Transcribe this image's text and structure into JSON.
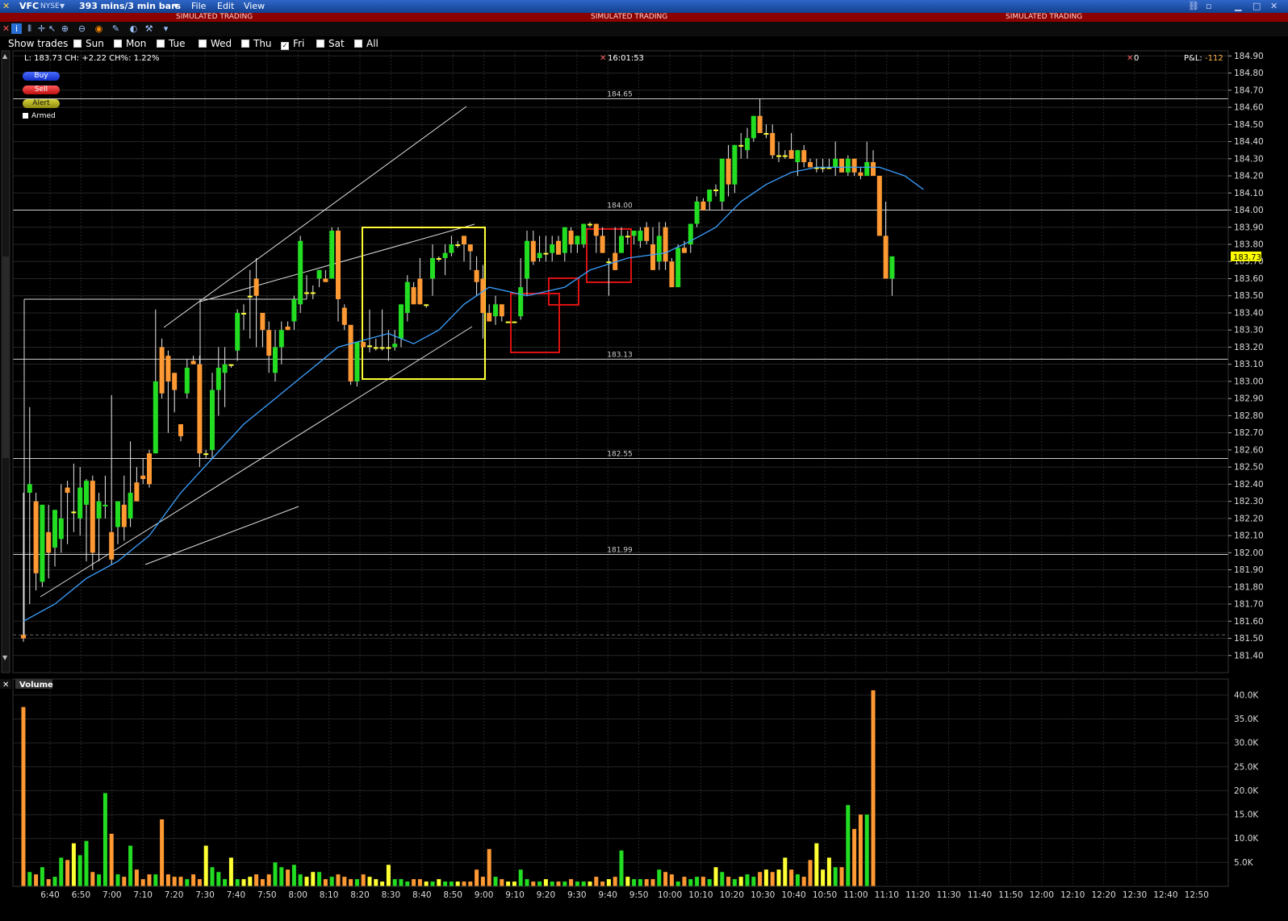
{
  "window": {
    "symbol": "VFC",
    "exchange": "NYSE",
    "bar_setting": "393 mins/3 min bars",
    "menu": [
      "File",
      "Edit",
      "View"
    ],
    "simulated_label": "SIMULATED TRADING"
  },
  "days_bar": {
    "label": "Show trades",
    "days": [
      {
        "label": "Sun",
        "checked": false
      },
      {
        "label": "Mon",
        "checked": false
      },
      {
        "label": "Tue",
        "checked": false
      },
      {
        "label": "Wed",
        "checked": false
      },
      {
        "label": "Thu",
        "checked": false
      },
      {
        "label": "Fri",
        "checked": true
      },
      {
        "label": "Sat",
        "checked": false
      },
      {
        "label": "All",
        "checked": false
      }
    ]
  },
  "info": {
    "quote": "L: 183.73 CH: +2.22 CH%: 1.22%",
    "time": "16:01:53",
    "position": "0",
    "pnl_label": "P&L:",
    "pnl_value": "-112"
  },
  "order_buttons": {
    "buy": "Buy",
    "sell": "Sell",
    "alert": "Alert",
    "armed": "Armed"
  },
  "colors": {
    "up": "#22dd22",
    "down": "#ff9933",
    "doji": "#ffff33",
    "ma": "#3aa0ff",
    "last_price_bg": "#ffff00"
  },
  "chart_data": [
    {
      "type": "candlestick",
      "interval": "3 min",
      "ylim": [
        181.3,
        184.93
      ],
      "y_ticks": [
        "184.90",
        "184.80",
        "184.70",
        "184.60",
        "184.50",
        "184.40",
        "184.30",
        "184.20",
        "184.10",
        "184.00",
        "183.90",
        "183.80",
        "183.70",
        "183.60",
        "183.50",
        "183.40",
        "183.30",
        "183.20",
        "183.10",
        "183.00",
        "182.90",
        "182.80",
        "182.70",
        "182.60",
        "182.50",
        "182.40",
        "182.30",
        "182.20",
        "182.10",
        "182.00",
        "181.90",
        "181.80",
        "181.70",
        "181.60",
        "181.50",
        "181.40"
      ],
      "x_ticks": [
        "6:40",
        "6:50",
        "7:00",
        "7:10",
        "7:20",
        "7:30",
        "7:40",
        "7:50",
        "8:00",
        "8:10",
        "8:20",
        "8:30",
        "8:40",
        "8:50",
        "9:00",
        "9:10",
        "9:20",
        "9:30",
        "9:40",
        "9:50",
        "10:00",
        "10:10",
        "10:20",
        "10:30",
        "10:40",
        "10:50",
        "11:00",
        "11:10",
        "11:20",
        "11:30",
        "11:40",
        "11:50",
        "12:00",
        "12:10",
        "12:20",
        "12:30",
        "12:40",
        "12:50"
      ],
      "last_price": 183.73,
      "last_price_label": "183.73",
      "horizontal_levels": [
        {
          "value": 184.65,
          "label": "184.65"
        },
        {
          "value": 184.0,
          "label": "184.00"
        },
        {
          "value": 183.13,
          "label": "183.13"
        },
        {
          "value": 182.55,
          "label": "182.55"
        },
        {
          "value": 181.99,
          "label": "181.99"
        }
      ],
      "candles": [
        [
          181.52,
          182.35,
          181.48,
          181.5
        ],
        [
          182.35,
          182.85,
          181.7,
          182.4
        ],
        [
          182.3,
          182.35,
          181.78,
          181.88
        ],
        [
          181.83,
          182.28,
          181.8,
          182.28
        ],
        [
          182.12,
          182.28,
          181.85,
          182.0
        ],
        [
          182.03,
          182.25,
          181.92,
          182.25
        ],
        [
          182.08,
          182.4,
          182.0,
          182.2
        ],
        [
          182.38,
          182.42,
          182.05,
          182.35
        ],
        [
          182.24,
          182.52,
          182.12,
          182.24
        ],
        [
          182.2,
          182.5,
          182.1,
          182.38
        ],
        [
          182.28,
          182.43,
          181.95,
          182.42
        ],
        [
          182.42,
          182.45,
          181.9,
          182.0
        ],
        [
          182.2,
          182.35,
          181.95,
          182.3
        ],
        [
          182.27,
          182.45,
          182.2,
          182.28
        ],
        [
          182.12,
          182.92,
          181.93,
          181.96
        ],
        [
          182.15,
          182.3,
          182.05,
          182.3
        ],
        [
          182.28,
          182.45,
          182.07,
          182.15
        ],
        [
          182.2,
          182.65,
          182.15,
          182.35
        ],
        [
          182.41,
          182.5,
          182.3,
          182.3
        ],
        [
          182.45,
          182.55,
          182.4,
          182.43
        ],
        [
          182.58,
          182.6,
          182.38,
          182.4
        ],
        [
          182.58,
          183.42,
          182.58,
          183.0
        ],
        [
          183.2,
          183.25,
          182.9,
          182.93
        ],
        [
          183.15,
          183.18,
          182.7,
          183.0
        ],
        [
          183.05,
          183.05,
          182.82,
          182.95
        ],
        [
          182.75,
          182.75,
          182.65,
          182.68
        ],
        [
          182.93,
          183.13,
          182.9,
          183.08
        ],
        [
          183.12,
          183.15,
          183.1,
          183.1
        ],
        [
          183.1,
          183.15,
          182.5,
          182.58
        ],
        [
          182.58,
          182.6,
          182.55,
          182.58
        ],
        [
          182.6,
          183.05,
          182.55,
          182.95
        ],
        [
          182.95,
          183.2,
          182.8,
          183.08
        ],
        [
          183.05,
          183.2,
          182.85,
          183.1
        ],
        [
          183.1,
          183.1,
          183.08,
          183.1
        ],
        [
          183.18,
          183.42,
          183.12,
          183.4
        ],
        [
          183.4,
          183.45,
          183.3,
          183.4
        ],
        [
          183.5,
          183.65,
          183.25,
          183.5
        ],
        [
          183.6,
          183.72,
          183.2,
          183.5
        ],
        [
          183.4,
          183.4,
          183.2,
          183.3
        ],
        [
          183.3,
          183.35,
          183.05,
          183.15
        ],
        [
          183.05,
          183.3,
          183.0,
          183.2
        ],
        [
          183.2,
          183.35,
          183.1,
          183.3
        ],
        [
          183.32,
          183.35,
          183.3,
          183.3
        ],
        [
          183.35,
          183.5,
          183.3,
          183.48
        ],
        [
          183.45,
          183.85,
          183.4,
          183.82
        ],
        [
          183.52,
          183.62,
          183.48,
          183.52
        ],
        [
          183.52,
          183.56,
          183.48,
          183.52
        ],
        [
          183.6,
          183.65,
          183.55,
          183.65
        ],
        [
          183.6,
          183.65,
          183.58,
          183.58
        ],
        [
          183.6,
          183.9,
          183.6,
          183.88
        ],
        [
          183.88,
          183.9,
          183.35,
          183.48
        ],
        [
          183.43,
          183.45,
          183.3,
          183.33
        ],
        [
          183.33,
          183.25,
          182.98,
          183.0
        ],
        [
          183.0,
          183.23,
          182.97,
          183.23
        ],
        [
          183.23,
          183.23,
          183.2,
          183.2
        ],
        [
          183.21,
          183.42,
          183.17,
          183.21
        ],
        [
          183.2,
          183.25,
          183.18,
          183.2
        ],
        [
          183.2,
          183.42,
          183.18,
          183.2
        ],
        [
          183.2,
          183.3,
          183.12,
          183.2
        ],
        [
          183.2,
          183.3,
          183.18,
          183.22
        ],
        [
          183.25,
          183.45,
          183.2,
          183.45
        ],
        [
          183.4,
          183.62,
          183.35,
          183.58
        ],
        [
          183.55,
          183.58,
          183.48,
          183.45
        ],
        [
          183.6,
          183.72,
          183.45,
          183.45
        ],
        [
          183.45,
          183.45,
          183.43,
          183.45
        ],
        [
          183.6,
          183.8,
          183.5,
          183.72
        ],
        [
          183.72,
          183.73,
          183.7,
          183.72
        ],
        [
          183.72,
          183.8,
          183.62,
          183.75
        ],
        [
          183.75,
          183.85,
          183.73,
          183.8
        ],
        [
          183.8,
          183.82,
          183.78,
          183.8
        ],
        [
          183.85,
          183.85,
          183.7,
          183.8
        ],
        [
          183.8,
          183.8,
          183.65,
          183.76
        ],
        [
          183.65,
          183.73,
          183.5,
          183.58
        ],
        [
          183.6,
          183.68,
          183.25,
          183.4
        ],
        [
          183.4,
          183.45,
          183.35,
          183.35
        ],
        [
          183.38,
          183.5,
          183.33,
          183.45
        ],
        [
          183.45,
          183.45,
          183.35,
          183.38
        ],
        [
          183.35,
          183.35,
          183.34,
          183.35
        ],
        [
          183.35,
          183.35,
          183.34,
          183.35
        ],
        [
          183.38,
          183.72,
          183.36,
          183.55
        ],
        [
          183.6,
          183.88,
          183.5,
          183.82
        ],
        [
          183.82,
          183.88,
          183.68,
          183.7
        ],
        [
          183.72,
          183.85,
          183.7,
          183.75
        ],
        [
          183.75,
          183.85,
          183.7,
          183.75
        ],
        [
          183.75,
          183.85,
          183.7,
          183.8
        ],
        [
          183.82,
          183.85,
          183.74,
          183.74
        ],
        [
          183.75,
          183.9,
          183.7,
          183.9
        ],
        [
          183.88,
          183.9,
          183.75,
          183.8
        ],
        [
          183.8,
          183.85,
          183.75,
          183.85
        ],
        [
          183.8,
          183.92,
          183.78,
          183.92
        ],
        [
          183.92,
          183.93,
          183.9,
          183.92
        ],
        [
          183.92,
          183.92,
          183.75,
          183.85
        ],
        [
          183.85,
          183.9,
          183.75,
          183.75
        ],
        [
          183.7,
          183.72,
          183.5,
          183.7
        ],
        [
          183.75,
          183.9,
          183.65,
          183.65
        ],
        [
          183.75,
          183.9,
          183.75,
          183.85
        ],
        [
          183.85,
          183.88,
          183.8,
          183.85
        ],
        [
          183.85,
          183.85,
          183.8,
          183.88
        ],
        [
          183.82,
          183.9,
          183.78,
          183.88
        ],
        [
          183.9,
          183.93,
          183.8,
          183.82
        ],
        [
          183.8,
          183.9,
          183.65,
          183.65
        ],
        [
          183.7,
          183.93,
          183.65,
          183.85
        ],
        [
          183.9,
          183.93,
          183.65,
          183.7
        ],
        [
          183.7,
          183.72,
          183.55,
          183.55
        ],
        [
          183.55,
          183.8,
          183.55,
          183.78
        ],
        [
          183.78,
          183.82,
          183.75,
          183.75
        ],
        [
          183.8,
          183.92,
          183.75,
          183.92
        ],
        [
          183.92,
          184.08,
          183.9,
          184.05
        ],
        [
          184.05,
          184.07,
          184.0,
          184.0
        ],
        [
          184.05,
          184.12,
          184.0,
          184.12
        ],
        [
          184.12,
          184.15,
          184.08,
          184.12
        ],
        [
          184.05,
          184.3,
          184.0,
          184.3
        ],
        [
          184.3,
          184.38,
          184.08,
          184.15
        ],
        [
          184.15,
          184.38,
          184.1,
          184.38
        ],
        [
          184.38,
          184.45,
          184.3,
          184.38
        ],
        [
          184.35,
          184.48,
          184.3,
          184.42
        ],
        [
          184.42,
          184.55,
          184.4,
          184.55
        ],
        [
          184.55,
          184.65,
          184.45,
          184.45
        ],
        [
          184.45,
          184.5,
          184.42,
          184.45
        ],
        [
          184.45,
          184.5,
          184.3,
          184.32
        ],
        [
          184.32,
          184.4,
          184.28,
          184.32
        ],
        [
          184.32,
          184.35,
          184.3,
          184.32
        ],
        [
          184.35,
          184.45,
          184.3,
          184.3
        ],
        [
          184.28,
          184.35,
          184.2,
          184.35
        ],
        [
          184.35,
          184.38,
          184.25,
          184.28
        ],
        [
          184.28,
          184.3,
          184.25,
          184.25
        ],
        [
          184.25,
          184.3,
          184.22,
          184.25
        ],
        [
          184.25,
          184.3,
          184.22,
          184.25
        ],
        [
          184.25,
          184.3,
          184.25,
          184.25
        ],
        [
          184.25,
          184.4,
          184.2,
          184.3
        ],
        [
          184.3,
          184.3,
          184.22,
          184.22
        ],
        [
          184.22,
          184.32,
          184.2,
          184.3
        ],
        [
          184.3,
          184.3,
          184.2,
          184.22
        ],
        [
          184.22,
          184.25,
          184.18,
          184.2
        ],
        [
          184.2,
          184.4,
          184.2,
          184.28
        ],
        [
          184.28,
          184.35,
          184.2,
          184.2
        ],
        [
          184.2,
          184.2,
          183.85,
          183.85
        ],
        [
          183.85,
          184.05,
          183.6,
          183.6
        ],
        [
          183.6,
          183.73,
          183.5,
          183.73
        ]
      ],
      "moving_average": [
        [
          0,
          181.6
        ],
        [
          5,
          181.7
        ],
        [
          10,
          181.85
        ],
        [
          15,
          181.95
        ],
        [
          20,
          182.1
        ],
        [
          25,
          182.35
        ],
        [
          30,
          182.55
        ],
        [
          35,
          182.75
        ],
        [
          40,
          182.9
        ],
        [
          45,
          183.05
        ],
        [
          50,
          183.2
        ],
        [
          55,
          183.25
        ],
        [
          58,
          183.28
        ],
        [
          62,
          183.22
        ],
        [
          66,
          183.3
        ],
        [
          70,
          183.45
        ],
        [
          74,
          183.55
        ],
        [
          80,
          183.5
        ],
        [
          86,
          183.55
        ],
        [
          90,
          183.65
        ],
        [
          96,
          183.72
        ],
        [
          102,
          183.75
        ],
        [
          106,
          183.82
        ],
        [
          110,
          183.9
        ],
        [
          114,
          184.05
        ],
        [
          118,
          184.15
        ],
        [
          122,
          184.22
        ],
        [
          126,
          184.25
        ],
        [
          132,
          184.25
        ],
        [
          136,
          184.25
        ],
        [
          140,
          184.2
        ],
        [
          143,
          184.12
        ]
      ]
    },
    {
      "type": "bar",
      "title": "Volume",
      "ylim": [
        0,
        42000
      ],
      "y_ticks": [
        "5.0K",
        "10.0K",
        "15.0K",
        "20.0K",
        "25.0K",
        "30.0K",
        "35.0K",
        "40.0K"
      ],
      "values": [
        37500,
        3000,
        2500,
        4000,
        1500,
        2000,
        6000,
        5500,
        9000,
        6500,
        9500,
        3000,
        2500,
        19500,
        11000,
        2500,
        2000,
        8500,
        3500,
        1500,
        2500,
        2500,
        14000,
        2500,
        2000,
        2000,
        1500,
        2500,
        1500,
        8500,
        4000,
        3000,
        1500,
        6000,
        1500,
        1500,
        2000,
        2500,
        1500,
        2500,
        5000,
        4000,
        3500,
        4500,
        2500,
        2000,
        3000,
        3000,
        1500,
        2000,
        2500,
        2000,
        1500,
        1500,
        2500,
        2000,
        1500,
        1000,
        4500,
        1500,
        1500,
        1000,
        1500,
        1500,
        1000,
        1000,
        1500,
        1000,
        1000,
        1000,
        1000,
        1000,
        3500,
        2000,
        7800,
        2000,
        1500,
        1000,
        1000,
        3500,
        1500,
        1000,
        1000,
        1500,
        1000,
        1000,
        1000,
        1500,
        1000,
        1000,
        1000,
        2000,
        1000,
        1500,
        2000,
        7500,
        2000,
        1500,
        1500,
        1500,
        1500,
        3500,
        3000,
        2500,
        1000,
        2000,
        1500,
        2000,
        2000,
        1500,
        4000,
        3000,
        2000,
        1500,
        2000,
        2500,
        2000,
        3000,
        3500,
        3000,
        3500,
        6000,
        3500,
        2500,
        2000,
        5500,
        9000,
        3500,
        6000,
        4000,
        4000,
        17000,
        12000,
        15000,
        15000,
        41000
      ],
      "up_down": "same as price candles"
    }
  ]
}
